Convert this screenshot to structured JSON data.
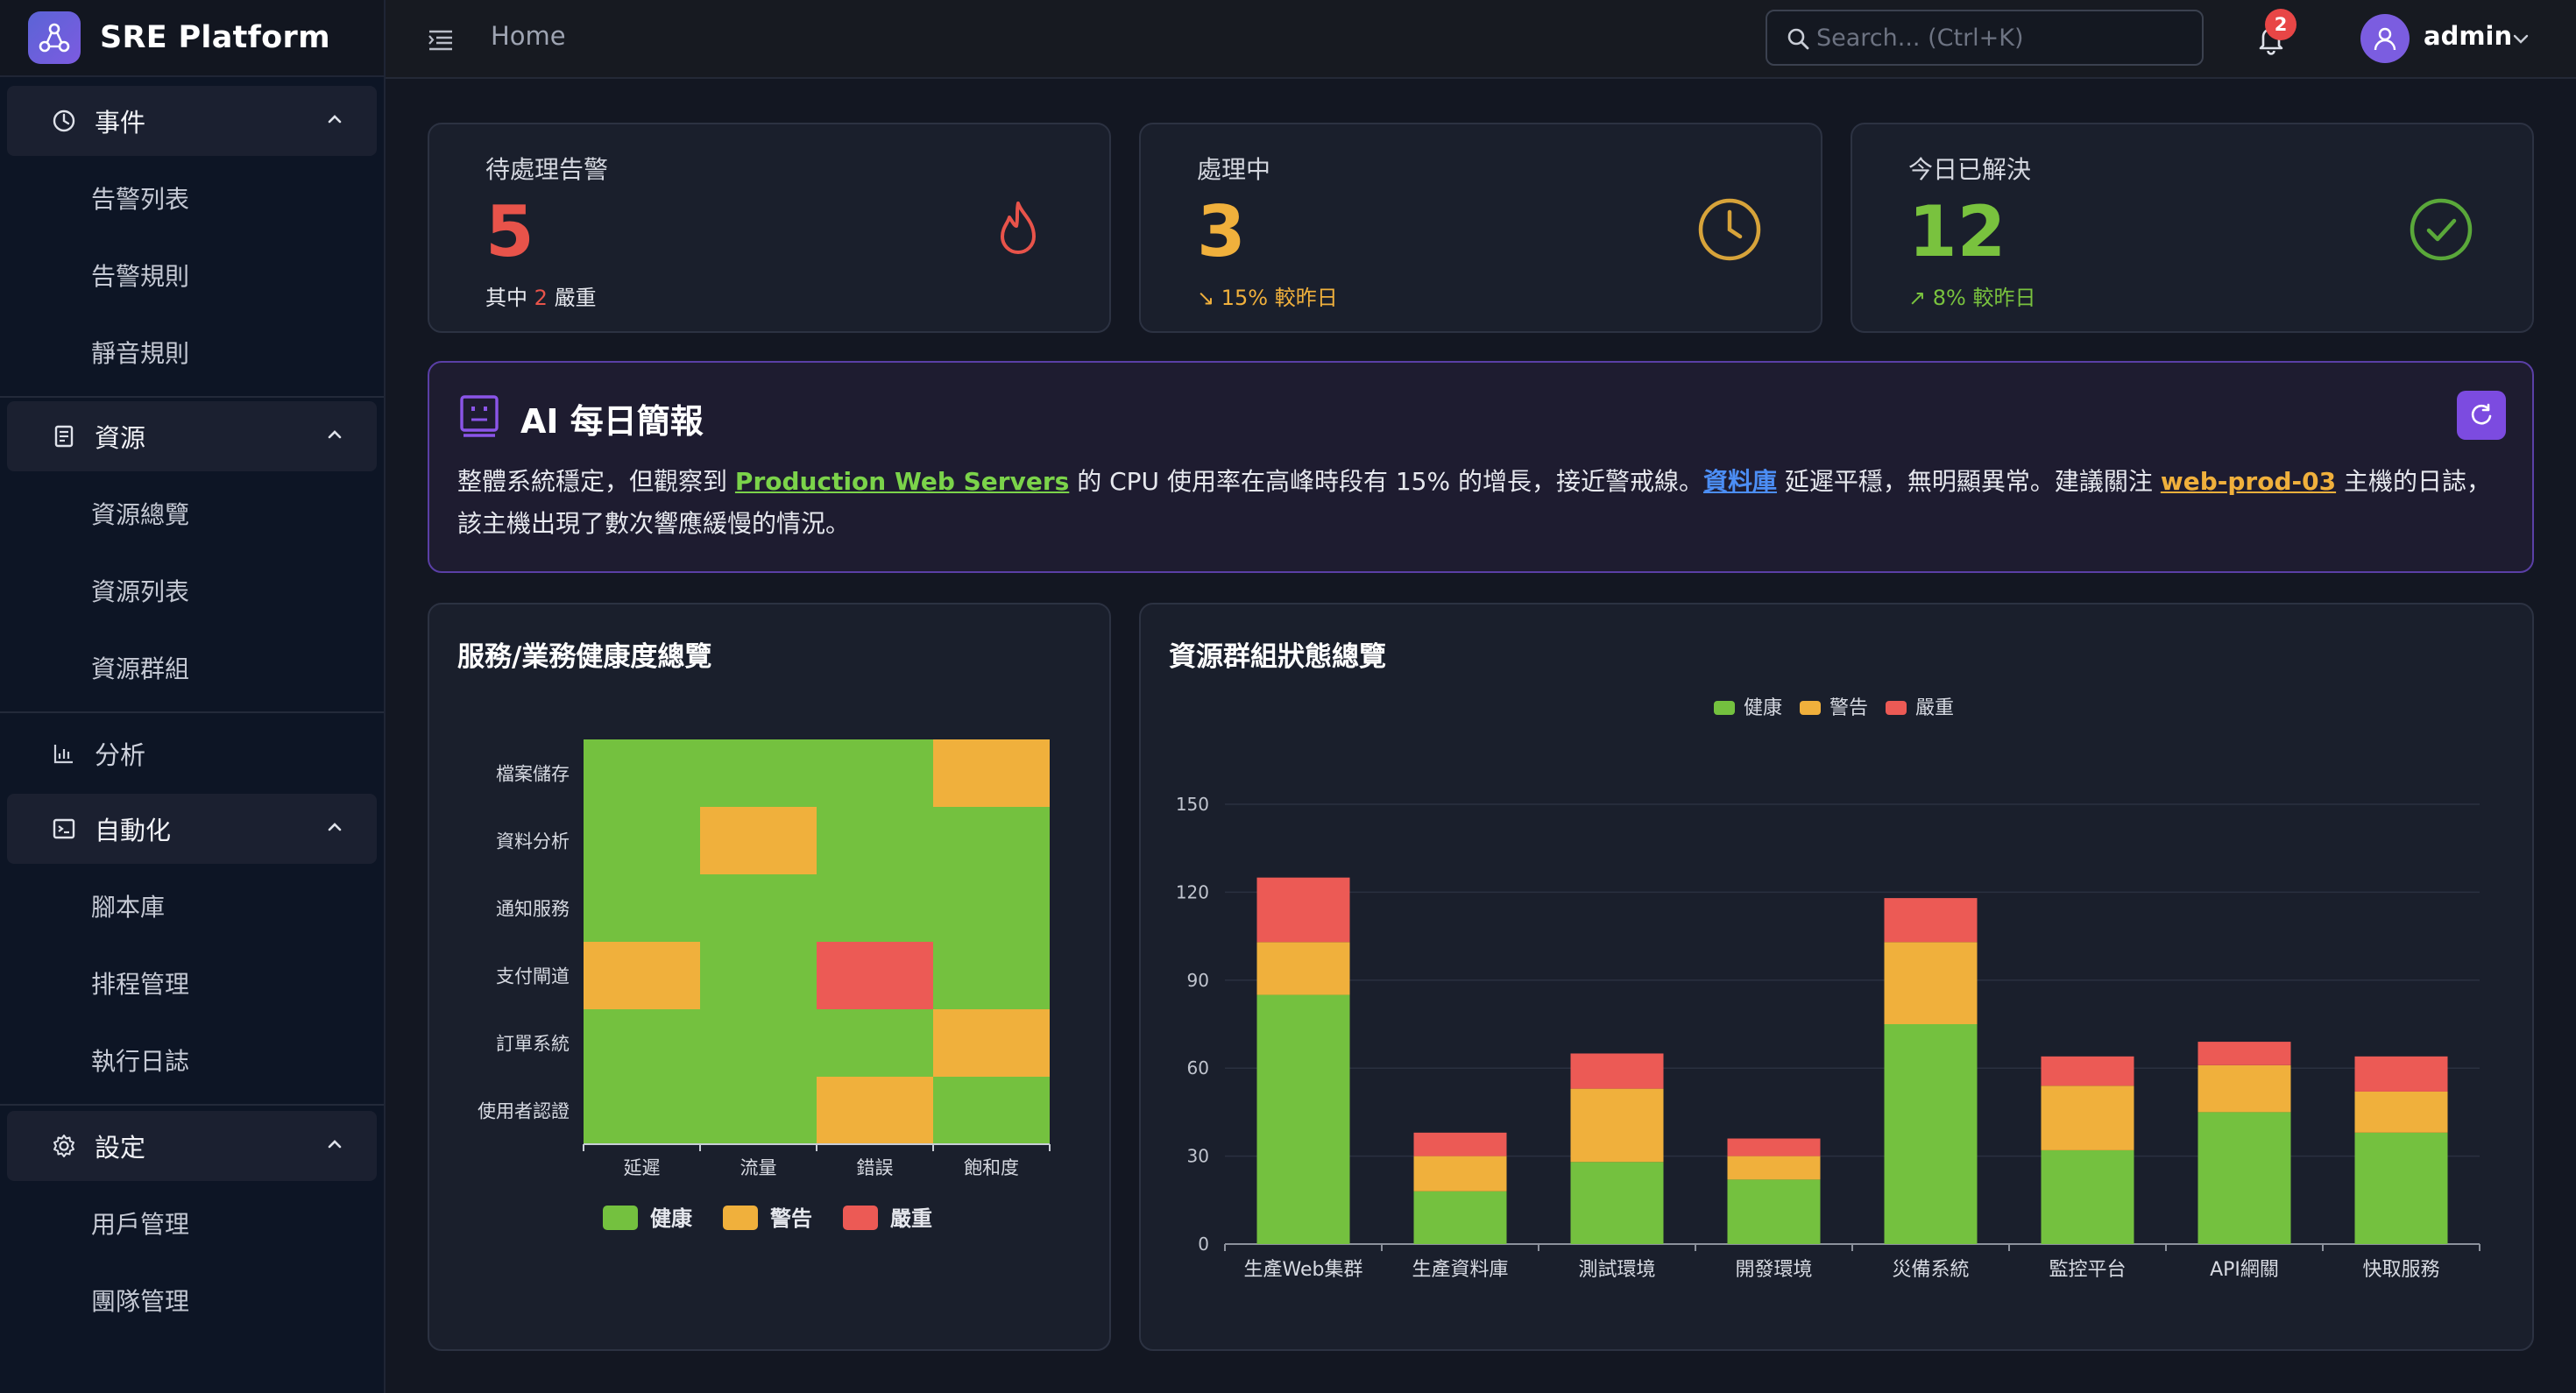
{
  "app": {
    "title": "SRE Platform"
  },
  "sidebar": {
    "groups": [
      {
        "label": "事件",
        "icon": "clock-icon",
        "items": [
          "告警列表",
          "告警規則",
          "靜音規則"
        ]
      },
      {
        "label": "資源",
        "icon": "server-icon",
        "items": [
          "資源總覽",
          "資源列表",
          "資源群組"
        ]
      },
      {
        "label": "分析",
        "icon": "bar-chart-icon",
        "items": []
      },
      {
        "label": "自動化",
        "icon": "terminal-icon",
        "items": [
          "腳本庫",
          "排程管理",
          "執行日誌"
        ]
      },
      {
        "label": "設定",
        "icon": "gear-icon",
        "items": [
          "用戶管理",
          "團隊管理"
        ]
      }
    ]
  },
  "header": {
    "breadcrumb": "Home",
    "search_placeholder": "Search... (Ctrl+K)",
    "notification_count": "2",
    "username": "admin"
  },
  "stats": [
    {
      "title": "待處理告警",
      "value": "5",
      "sub_prefix": "其中",
      "sub_highlight": "2",
      "sub_suffix": "嚴重",
      "color": "#e8534a",
      "icon": "flame-icon"
    },
    {
      "title": "處理中",
      "value": "3",
      "sub": "↘ 15% 較昨日",
      "color": "#f0b03c",
      "icon": "clock-icon"
    },
    {
      "title": "今日已解決",
      "value": "12",
      "sub": "↗ 8% 較昨日",
      "color": "#79c23e",
      "icon": "check-circle-icon"
    }
  ],
  "ai_briefing": {
    "title": "AI 每日簡報",
    "text_1": "整體系統穩定，但觀察到",
    "link_1": "Production Web Servers",
    "text_2": "的 CPU 使用率在高峰時段有 15% 的增長，接近警戒線。",
    "link_2": "資料庫",
    "text_3": "延遲平穩，無明顯異常。建議關注",
    "link_3": "web-prod-03",
    "text_4": "主機的日誌，該主機出現了數次響應緩慢的情況。"
  },
  "colors": {
    "healthy": "#74c13f",
    "warning": "#f0b03c",
    "critical": "#ec5a55",
    "accent": "#7c4be0"
  },
  "chart_data": [
    {
      "type": "heatmap",
      "title": "服務/業務健康度總覽",
      "x_categories": [
        "延遲",
        "流量",
        "錯誤",
        "飽和度"
      ],
      "y_categories": [
        "檔案儲存",
        "資料分析",
        "通知服務",
        "支付閘道",
        "訂單系統",
        "使用者認證"
      ],
      "values": [
        [
          "健康",
          "健康",
          "健康",
          "警告"
        ],
        [
          "健康",
          "警告",
          "健康",
          "健康"
        ],
        [
          "健康",
          "健康",
          "健康",
          "健康"
        ],
        [
          "警告",
          "健康",
          "嚴重",
          "健康"
        ],
        [
          "健康",
          "健康",
          "健康",
          "警告"
        ],
        [
          "健康",
          "健康",
          "警告",
          "健康"
        ]
      ],
      "legend": [
        "健康",
        "警告",
        "嚴重"
      ],
      "legend_position": "bottom"
    },
    {
      "type": "bar",
      "stacked": true,
      "title": "資源群組狀態總覽",
      "categories": [
        "生產Web集群",
        "生產資料庫",
        "測試環境",
        "開發環境",
        "災備系統",
        "監控平台",
        "API網關",
        "快取服務"
      ],
      "series": [
        {
          "name": "健康",
          "values": [
            85,
            18,
            28,
            22,
            75,
            32,
            45,
            38
          ]
        },
        {
          "name": "警告",
          "values": [
            18,
            12,
            25,
            8,
            28,
            22,
            16,
            14
          ]
        },
        {
          "name": "嚴重",
          "values": [
            22,
            8,
            12,
            6,
            15,
            10,
            8,
            12
          ]
        }
      ],
      "ylim": [
        0,
        150
      ],
      "yticks": [
        0,
        30,
        60,
        90,
        120,
        150
      ],
      "legend_position": "top",
      "grid": true
    }
  ]
}
